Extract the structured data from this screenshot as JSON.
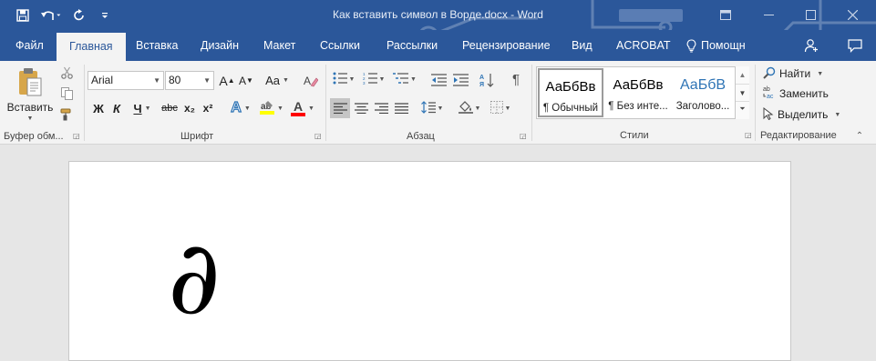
{
  "window": {
    "title": "Как вставить символ в Ворде.docx - Word"
  },
  "quick_access": [
    "save-icon",
    "undo-icon",
    "redo-icon",
    "customize-qat-icon"
  ],
  "tabs": [
    {
      "label": "Файл"
    },
    {
      "label": "Главная"
    },
    {
      "label": "Вставка"
    },
    {
      "label": "Дизайн"
    },
    {
      "label": "Макет"
    },
    {
      "label": "Ссылки"
    },
    {
      "label": "Рассылки"
    },
    {
      "label": "Рецензирование"
    },
    {
      "label": "Вид"
    },
    {
      "label": "ACROBAT"
    },
    {
      "label": "Помощн"
    }
  ],
  "ribbon": {
    "clipboard": {
      "label": "Буфер обм...",
      "paste_label": "Вставить"
    },
    "font": {
      "label": "Шрифт",
      "font_name": "Arial",
      "font_size": "80",
      "aa_label": "Aa",
      "bold": "Ж",
      "italic": "К",
      "underline": "Ч",
      "strike": "abc",
      "subscript": "x₂",
      "superscript": "x²",
      "grow": "A",
      "shrink": "A",
      "effects": "A",
      "font_color": "A"
    },
    "paragraph": {
      "label": "Абзац"
    },
    "styles": {
      "label": "Стили",
      "items": [
        {
          "preview": "АаБбВв",
          "name": "¶ Обычный"
        },
        {
          "preview": "АаБбВв",
          "name": "¶ Без инте..."
        },
        {
          "preview": "АаБбВ",
          "name": "Заголово..."
        }
      ]
    },
    "editing": {
      "label": "Редактирование",
      "find": "Найти",
      "replace": "Заменить",
      "select": "Выделить"
    }
  },
  "document": {
    "content": "∂"
  },
  "colors": {
    "brand": "#2b579a",
    "ribbon_bg": "#f3f3f3",
    "heading_style": "#2e74b5",
    "highlight": "#ffff00",
    "font_color_bar": "#ff0000"
  }
}
